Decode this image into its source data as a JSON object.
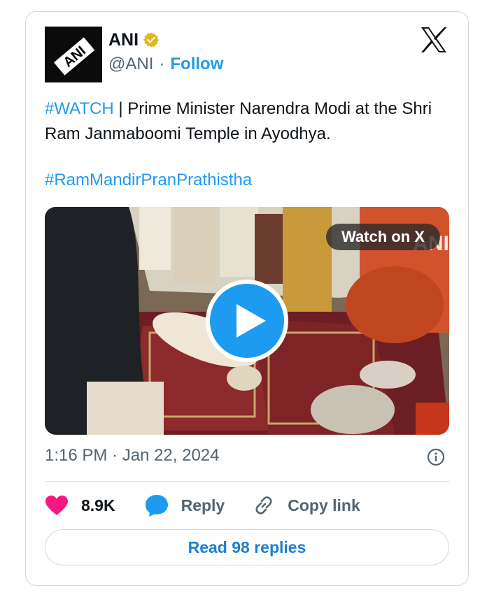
{
  "author": {
    "name": "ANI",
    "handle": "@ANI",
    "separator": "·",
    "follow_label": "Follow",
    "avatar_text": "ANI"
  },
  "tweet": {
    "hashtag1": "#WATCH",
    "body": " | Prime Minister Narendra Modi at the Shri Ram Janmaboomi Temple in Ayodhya.",
    "hashtag2": "#RamMandirPranPrathistha"
  },
  "media": {
    "watch_label": "Watch on X",
    "watermark": "ANI"
  },
  "meta": {
    "timestamp": "1:16 PM · Jan 22, 2024"
  },
  "actions": {
    "like_count": "8.9K",
    "reply_label": "Reply",
    "copy_label": "Copy link",
    "read_replies_label": "Read 98 replies"
  },
  "icons": [
    "verified-badge-icon",
    "x-logo-icon",
    "play-icon",
    "info-icon",
    "heart-icon",
    "reply-bubble-icon",
    "link-icon"
  ],
  "colors": {
    "accent": "#1d9bf0",
    "heart": "#f91880",
    "verified": "#e2b719",
    "muted": "#536471",
    "border": "#cfd9de"
  }
}
